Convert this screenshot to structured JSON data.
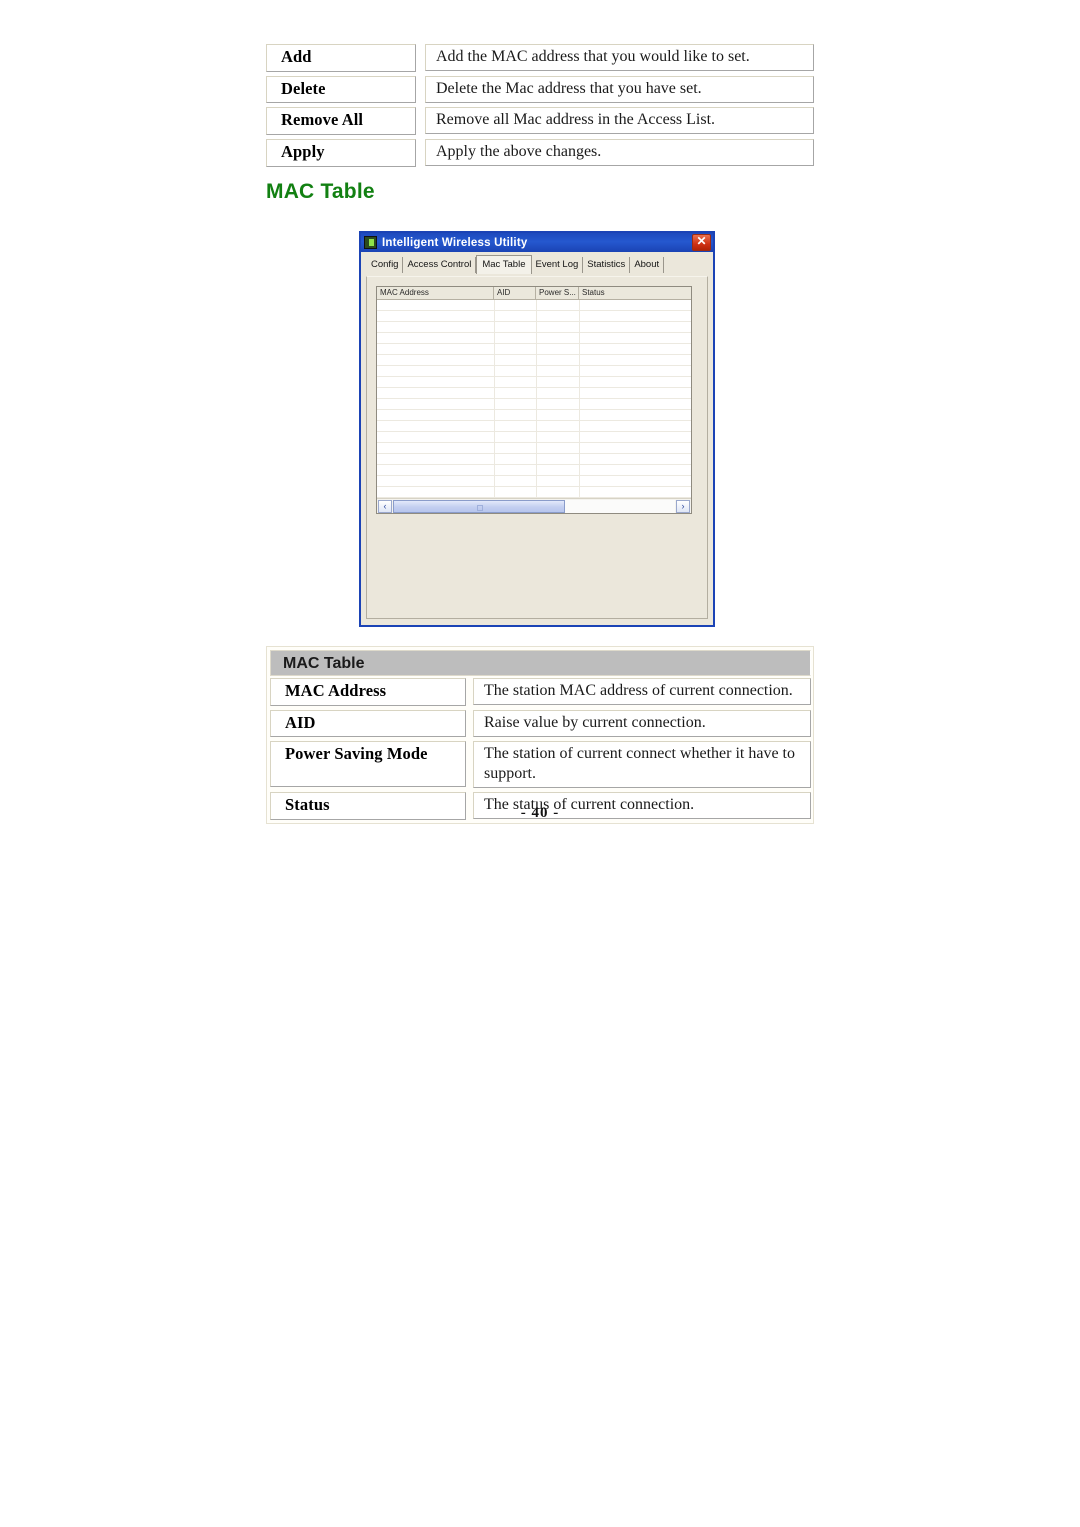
{
  "page": {
    "footer": "- 40 -",
    "heading": "MAC Table"
  },
  "operations_table": {
    "rows": [
      {
        "key": "Add",
        "value": "Add the MAC address that you would like to set."
      },
      {
        "key": "Delete",
        "value": "Delete the Mac address that you have set."
      },
      {
        "key": "Remove All",
        "value": "Remove all Mac address in the Access List."
      },
      {
        "key": "Apply",
        "value": "Apply the above changes."
      }
    ]
  },
  "app_window": {
    "title": "Intelligent Wireless Utility",
    "icon": "app-icon",
    "close_label": "✕",
    "tabs": [
      {
        "label": "Config",
        "active": false
      },
      {
        "label": "Access Control",
        "active": false
      },
      {
        "label": "Mac Table",
        "active": true
      },
      {
        "label": "Event Log",
        "active": false
      },
      {
        "label": "Statistics",
        "active": false
      },
      {
        "label": "About",
        "active": false
      }
    ],
    "listview": {
      "columns": [
        "MAC Address",
        "AID",
        "Power S...",
        "Status"
      ],
      "rows": [],
      "scrollbar": {
        "left_arrow": "‹",
        "right_arrow": "›",
        "thumb_percent": 61
      }
    }
  },
  "mac_table_desc": {
    "header": "MAC Table",
    "rows": [
      {
        "key": "MAC Address",
        "value": "The station MAC address of current connection."
      },
      {
        "key": "AID",
        "value": "Raise value by current connection."
      },
      {
        "key": "Power Saving Mode",
        "value": "The station of current connect whether it have to support."
      },
      {
        "key": "Status",
        "value": "The status of current connection."
      }
    ]
  },
  "colors": {
    "heading_green": "#128012",
    "titlebar_blue": "#2558cf",
    "dialog_beige": "#ebe7db",
    "desc_header_gray": "#bdbdbd",
    "close_red": "#cf3114"
  }
}
